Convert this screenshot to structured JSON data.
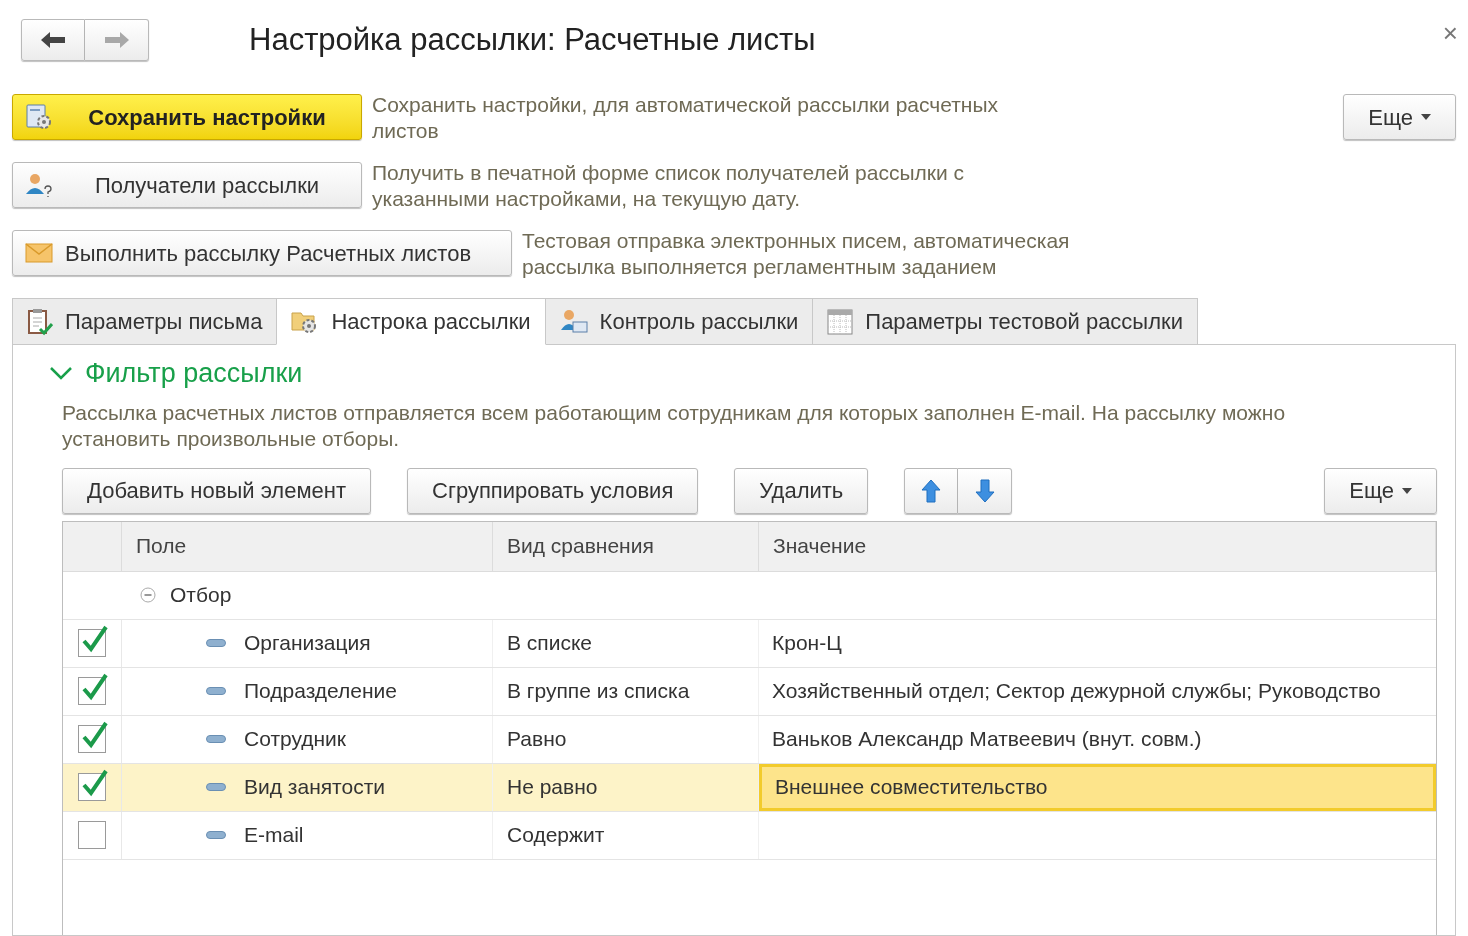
{
  "window": {
    "title": "Настройка рассылки: Расчетные листы",
    "close": "×"
  },
  "nav": [
    {
      "kind": "back",
      "disabled": false
    },
    {
      "kind": "forward",
      "disabled": true
    }
  ],
  "commands": [
    {
      "kind": "primary",
      "label": "Сохранить настройки",
      "description": "Сохранить настройки, для автоматической рассылки расчетных листов"
    },
    {
      "kind": "normal",
      "label": "Получатели рассылки",
      "description": "Получить в печатной форме список получателей рассылки с указанными настройками, на текущую дату."
    },
    {
      "kind": "normal",
      "label": "Выполнить рассылку Расчетных листов",
      "description": "Тестовая отправка электронных писем, автоматическая рассылка выполняется регламентным заданием"
    }
  ],
  "more_button": "Еще",
  "tabs": [
    {
      "label": "Параметры письма",
      "selected": false
    },
    {
      "label": "Настрока рассылки",
      "selected": true
    },
    {
      "label": "Контроль рассылки",
      "selected": false
    },
    {
      "label": "Параметры тестовой рассылки",
      "selected": false
    }
  ],
  "group": {
    "title": "Фильтр рассылки",
    "expanded": true,
    "description": "Рассылка расчетных листов отправляется всем работающим сотрудникам для которых заполнен E-mail. На рассылку можно установить произвольные отборы."
  },
  "toolbar": {
    "buttons": [
      "Добавить новый элемент",
      "Сгруппировать условия",
      "Удалить"
    ],
    "more": "Еще"
  },
  "table": {
    "columns": [
      "Поле",
      "Вид сравнения",
      "Значение"
    ],
    "rows": [
      {
        "field": "Отбор",
        "expanded": true,
        "children": [
          {
            "checked": true,
            "selected": false,
            "field": "Организация",
            "comparison": "В списке",
            "value": "Крон-Ц"
          },
          {
            "checked": true,
            "selected": false,
            "field": "Подразделение",
            "comparison": "В группе из списка",
            "value": "Хозяйственный отдел; Сектор дежурной службы; Руководство"
          },
          {
            "checked": true,
            "selected": false,
            "field": "Сотрудник",
            "comparison": "Равно",
            "value": "Ваньков Александр Матвеевич (внут. совм.)"
          },
          {
            "checked": true,
            "selected": true,
            "field": "Вид занятости",
            "comparison": "Не равно",
            "value": "Внешнее совместительство"
          },
          {
            "checked": false,
            "selected": false,
            "field": "E-mail",
            "comparison": "Содержит"
          }
        ]
      }
    ]
  }
}
